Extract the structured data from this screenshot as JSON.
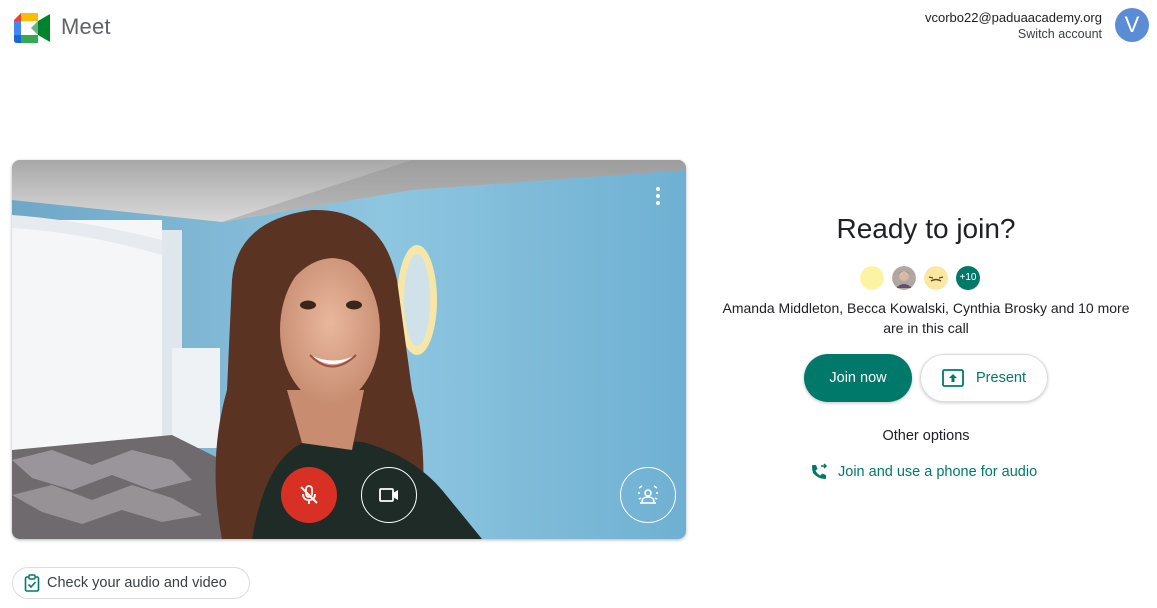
{
  "header": {
    "product_name": "Meet",
    "account_email": "vcorbo22@paduaacademy.org",
    "switch_account_label": "Switch account",
    "avatar_initial": "V"
  },
  "preview": {
    "more_options_icon": "more-vert-icon",
    "mic_state": "off",
    "camera_state": "on",
    "mic_icon": "mic-off-icon",
    "camera_icon": "videocam-icon",
    "effects_icon": "visual-effects-icon"
  },
  "join_panel": {
    "title": "Ready to join?",
    "participants_more_count": "+10",
    "in_call_text": "Amanda Middleton, Becca Kowalski, Cynthia Brosky and 10 more are in this call",
    "join_now_label": "Join now",
    "present_label": "Present",
    "other_options_label": "Other options",
    "phone_audio_label": "Join and use a phone for audio"
  },
  "footer": {
    "check_audio_video_label": "Check your audio and video"
  },
  "colors": {
    "accent": "#00796b",
    "mic_off_red": "#d93025",
    "avatar_blue": "#5b8dd6"
  }
}
